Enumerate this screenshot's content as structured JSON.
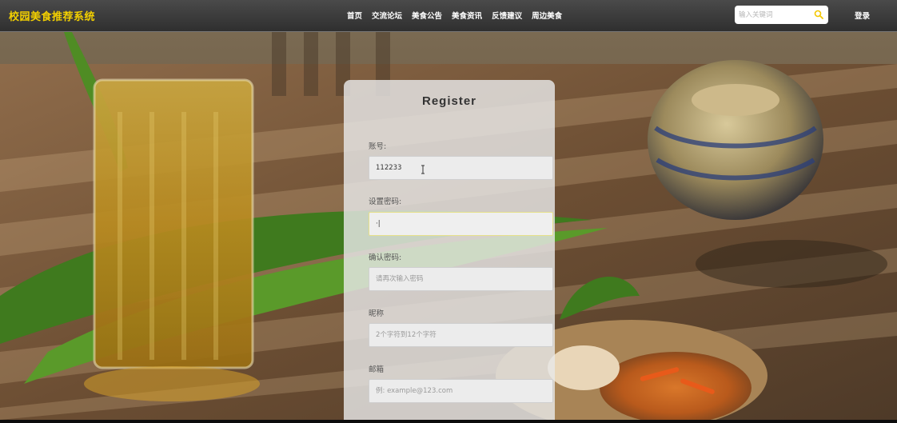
{
  "header": {
    "brand": "校园美食推荐系统",
    "nav": [
      "首页",
      "交流论坛",
      "美食公告",
      "美食资讯",
      "反馈建议",
      "周边美食"
    ],
    "search_placeholder": "输入关键词",
    "search_icon": "search-icon",
    "login_label": "登录"
  },
  "register": {
    "title": "Register",
    "fields": {
      "account": {
        "label": "账号:",
        "value": "112233",
        "placeholder": ""
      },
      "password": {
        "label": "设置密码:",
        "value": "·|",
        "placeholder": ""
      },
      "confirm_password": {
        "label": "确认密码:",
        "value": "",
        "placeholder": "请再次输入密码"
      },
      "nickname": {
        "label": "昵称",
        "value": "",
        "placeholder": "2个字符到12个字符"
      },
      "email": {
        "label": "邮箱",
        "value": "",
        "placeholder": "例: example@123.com"
      }
    }
  },
  "colors": {
    "brand": "#f3d000",
    "header_bg": "#3a3a3a",
    "search_icon": "#f3c700"
  }
}
